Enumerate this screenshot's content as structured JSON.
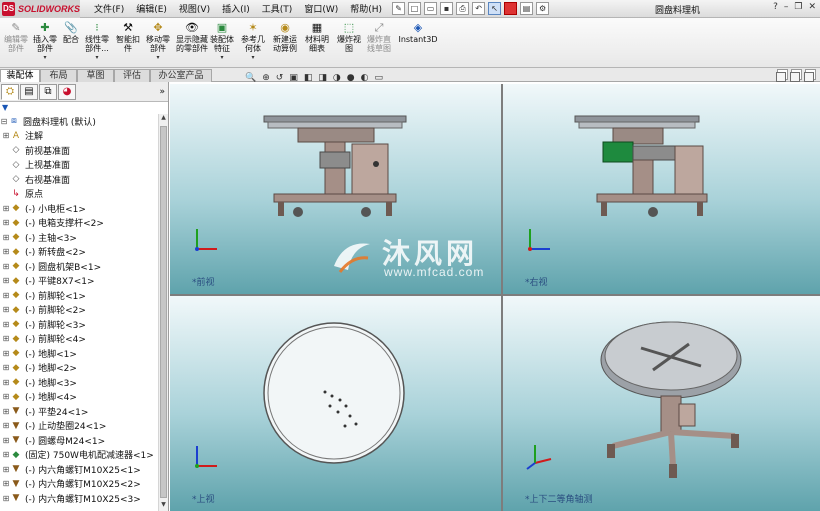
{
  "app": {
    "brand": "SOLIDWORKS",
    "brand_badge": "DS",
    "document_title": "圆盘料理机"
  },
  "menu": {
    "items": [
      "文件(F)",
      "编辑(E)",
      "视图(V)",
      "插入(I)",
      "工具(T)",
      "窗口(W)",
      "帮助(H)"
    ],
    "help_icon": "?"
  },
  "command_manager": {
    "buttons": [
      {
        "label": "编辑零部件",
        "icon": "edit-component-icon",
        "enabled": false
      },
      {
        "label": "插入零部件",
        "icon": "insert-component-icon",
        "enabled": true
      },
      {
        "label": "配合",
        "icon": "mate-icon",
        "enabled": true
      },
      {
        "label": "线性零部件...",
        "icon": "linear-pattern-icon",
        "enabled": true
      },
      {
        "label": "智能扣件",
        "icon": "smart-fastener-icon",
        "enabled": true
      },
      {
        "label": "移动零部件",
        "icon": "move-component-icon",
        "enabled": true
      },
      {
        "label": "显示隐藏的零部件",
        "icon": "show-hidden-icon",
        "enabled": true
      },
      {
        "label": "装配体特征",
        "icon": "assembly-feature-icon",
        "enabled": true
      },
      {
        "label": "参考几何体",
        "icon": "reference-geometry-icon",
        "enabled": true
      },
      {
        "label": "新建运动算例",
        "icon": "motion-study-icon",
        "enabled": true
      },
      {
        "label": "材料明细表",
        "icon": "bom-icon",
        "enabled": true
      },
      {
        "label": "爆炸视图",
        "icon": "explode-view-icon",
        "enabled": true
      },
      {
        "label": "爆炸直线草图",
        "icon": "explode-line-icon",
        "enabled": false
      },
      {
        "label": "Instant3D",
        "icon": "instant3d-icon",
        "enabled": true
      }
    ]
  },
  "tabs": [
    {
      "label": "装配体",
      "active": true
    },
    {
      "label": "布局",
      "active": false
    },
    {
      "label": "草图",
      "active": false
    },
    {
      "label": "评估",
      "active": false
    },
    {
      "label": "办公室产品",
      "active": false
    }
  ],
  "feature_manager": {
    "expand_icon": "»",
    "filter_icon": "▼",
    "tree": [
      {
        "label": "圆盘料理机  (默认)",
        "type": "asm",
        "expand": "-",
        "indent": 0
      },
      {
        "label": "注解",
        "type": "note",
        "expand": "+",
        "indent": 1
      },
      {
        "label": "前视基准面",
        "type": "plane",
        "expand": "",
        "indent": 1
      },
      {
        "label": "上视基准面",
        "type": "plane",
        "expand": "",
        "indent": 1
      },
      {
        "label": "右视基准面",
        "type": "plane",
        "expand": "",
        "indent": 1
      },
      {
        "label": "原点",
        "type": "origin",
        "expand": "",
        "indent": 1
      },
      {
        "label": "(-) 小电柜<1>",
        "type": "part",
        "expand": "+",
        "indent": 1
      },
      {
        "label": "(-) 电箱支撑杆<2>",
        "type": "part",
        "expand": "+",
        "indent": 1
      },
      {
        "label": "(-) 主轴<3>",
        "type": "part",
        "expand": "+",
        "indent": 1
      },
      {
        "label": "(-) 新转盘<2>",
        "type": "part",
        "expand": "+",
        "indent": 1
      },
      {
        "label": "(-) 圆盘机架B<1>",
        "type": "part",
        "expand": "+",
        "indent": 1
      },
      {
        "label": "(-) 平键8X7<1>",
        "type": "part",
        "expand": "+",
        "indent": 1
      },
      {
        "label": "(-) 前脚轮<1>",
        "type": "part",
        "expand": "+",
        "indent": 1
      },
      {
        "label": "(-) 前脚轮<2>",
        "type": "part",
        "expand": "+",
        "indent": 1
      },
      {
        "label": "(-) 前脚轮<3>",
        "type": "part",
        "expand": "+",
        "indent": 1
      },
      {
        "label": "(-) 前脚轮<4>",
        "type": "part",
        "expand": "+",
        "indent": 1
      },
      {
        "label": "(-) 地脚<1>",
        "type": "part",
        "expand": "+",
        "indent": 1
      },
      {
        "label": "(-) 地脚<2>",
        "type": "part",
        "expand": "+",
        "indent": 1
      },
      {
        "label": "(-) 地脚<3>",
        "type": "part",
        "expand": "+",
        "indent": 1
      },
      {
        "label": "(-) 地脚<4>",
        "type": "part",
        "expand": "+",
        "indent": 1
      },
      {
        "label": "(-) 平垫24<1>",
        "type": "tool",
        "expand": "+",
        "indent": 1
      },
      {
        "label": "(-) 止动垫圈24<1>",
        "type": "tool",
        "expand": "+",
        "indent": 1
      },
      {
        "label": "(-) 圆螺母M24<1>",
        "type": "tool",
        "expand": "+",
        "indent": 1
      },
      {
        "label": "(固定) 750W电机配减速器<1>",
        "type": "fix",
        "expand": "+",
        "indent": 1
      },
      {
        "label": "(-) 内六角螺钉M10X25<1>",
        "type": "tool",
        "expand": "+",
        "indent": 1
      },
      {
        "label": "(-) 内六角螺钉M10X25<2>",
        "type": "tool",
        "expand": "+",
        "indent": 1
      },
      {
        "label": "(-) 内六角螺钉M10X25<3>",
        "type": "tool",
        "expand": "+",
        "indent": 1
      }
    ]
  },
  "viewports": [
    {
      "label": "*前视"
    },
    {
      "label": "*右视"
    },
    {
      "label": "*上视"
    },
    {
      "label": "*上下二等角轴测"
    }
  ],
  "watermark": {
    "title": "沐风网",
    "url": "www.mfcad.com"
  },
  "colors": {
    "frame": "#a08c84",
    "frame_dark": "#6e5a52",
    "disk": "#9ca1a7",
    "motor": "#1e8a3e",
    "axis_x": "#d01b1b",
    "axis_y": "#1ea01e",
    "axis_z": "#1b3fd0"
  }
}
